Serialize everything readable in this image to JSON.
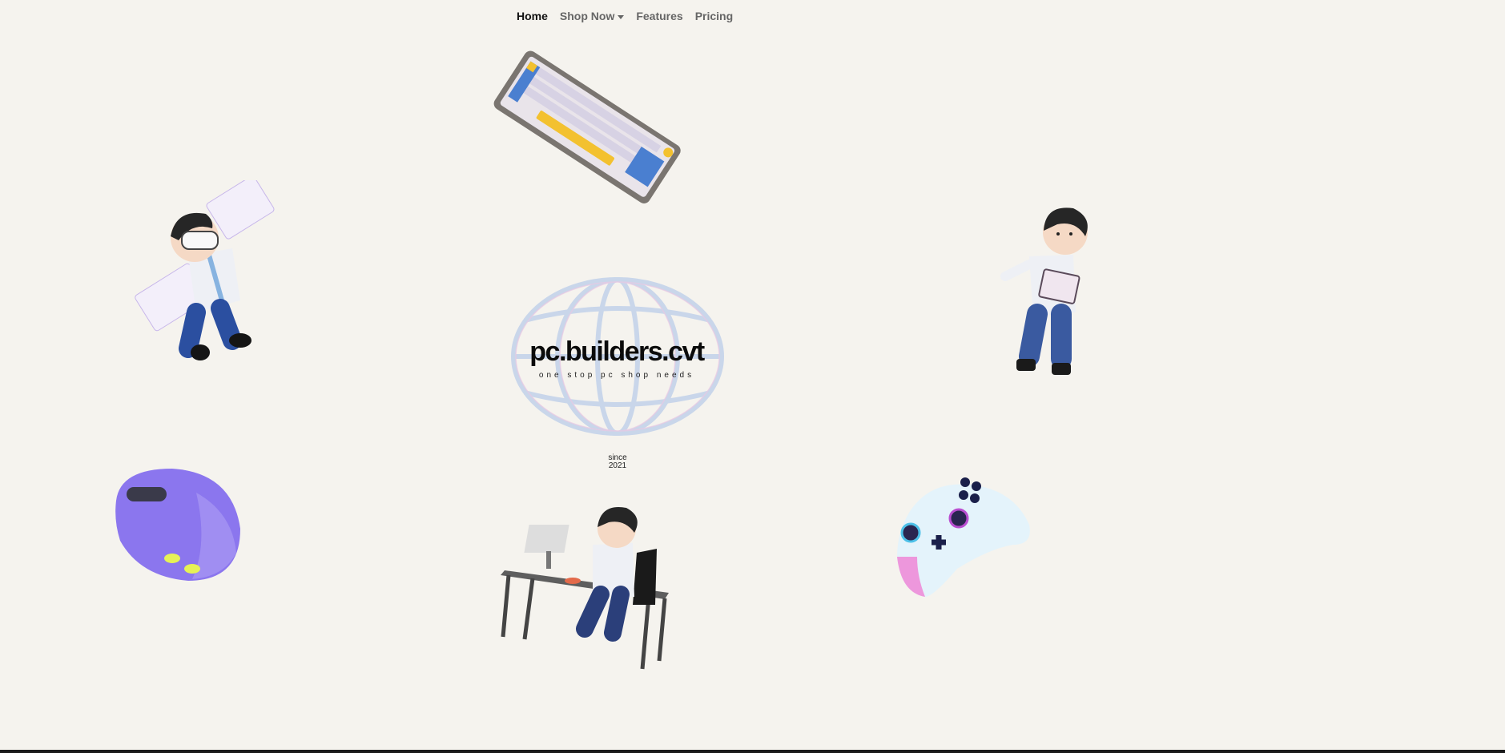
{
  "nav": {
    "home": "Home",
    "shop_now": "Shop Now",
    "features": "Features",
    "pricing": "Pricing"
  },
  "logo": {
    "title": "pc.builders.cvt",
    "tagline": "one stop pc shop needs",
    "since_label": "since",
    "since_year": "2021"
  },
  "colors": {
    "background": "#f5f3ee",
    "nav_active": "#111111",
    "nav_inactive": "#666666"
  },
  "icons": [
    "keyboard-icon",
    "vr-character-icon",
    "laptop-character-icon",
    "globe-icon",
    "mouse-icon",
    "desk-character-icon",
    "gamepad-icon",
    "chevron-down-icon"
  ]
}
